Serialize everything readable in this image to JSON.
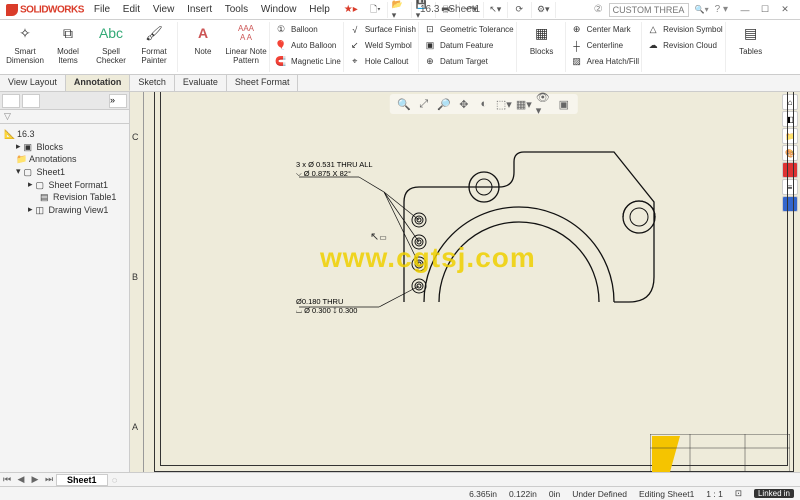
{
  "app": {
    "name": "SOLIDWORKS",
    "doc_title": "16.3 - Sheet1"
  },
  "menu": {
    "file": "File",
    "edit": "Edit",
    "view": "View",
    "insert": "Insert",
    "tools": "Tools",
    "window": "Window",
    "help": "Help"
  },
  "search": {
    "placeholder": "CUSTOM THREAD"
  },
  "ribbon": {
    "smart_dimension": "Smart Dimension",
    "model_items": "Model Items",
    "spell_checker": "Spell Checker",
    "format_painter": "Format Painter",
    "note": "Note",
    "linear_note_pattern": "Linear Note Pattern",
    "balloon": "Balloon",
    "auto_balloon": "Auto Balloon",
    "magnetic_line": "Magnetic Line",
    "surface_finish": "Surface Finish",
    "weld_symbol": "Weld Symbol",
    "hole_callout": "Hole Callout",
    "geometric_tolerance": "Geometric Tolerance",
    "datum_feature": "Datum Feature",
    "datum_target": "Datum Target",
    "blocks": "Blocks",
    "center_mark": "Center Mark",
    "centerline": "Centerline",
    "area_hatch": "Area Hatch/Fill",
    "revision_symbol": "Revision Symbol",
    "revision_cloud": "Revision Cloud",
    "tables": "Tables"
  },
  "tabs": {
    "view_layout": "View Layout",
    "annotation": "Annotation",
    "sketch": "Sketch",
    "evaluate": "Evaluate",
    "sheet_format": "Sheet Format"
  },
  "tree": {
    "root": "16.3",
    "blocks": "Blocks",
    "annotations": "Annotations",
    "sheet1": "Sheet1",
    "sheet_format1": "Sheet Format1",
    "revision_table1": "Revision Table1",
    "drawing_view1": "Drawing View1"
  },
  "dimensions": {
    "callout1_line1": "3 x Ø 0.531 THRU ALL",
    "callout1_line2": "⌵ Ø 0.875 X 82°",
    "callout2_line1": "Ø0.180 THRU",
    "callout2_line2": "⌴ Ø 0.300 ↧ 0.300"
  },
  "ruler": {
    "a": "A",
    "b": "B",
    "c": "C"
  },
  "sheet_tabs": {
    "sheet1": "Sheet1"
  },
  "status": {
    "x": "6.365in",
    "y": "0.122in",
    "z": "0in",
    "state": "Under Defined",
    "mode": "Editing Sheet1",
    "scale": "1 : 1"
  },
  "brand_footer": "Linked in",
  "watermark": "www.cgtsj.com"
}
